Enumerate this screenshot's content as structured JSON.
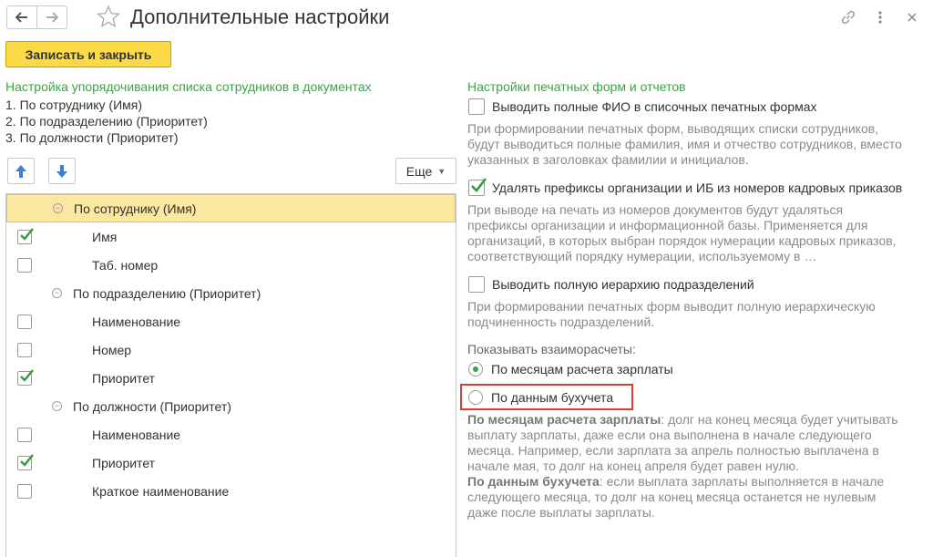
{
  "window": {
    "title": "Дополнительные настройки",
    "nav_back_icon": "arrow-left-icon",
    "nav_forward_icon": "arrow-right-icon",
    "favorite_icon": "star-icon",
    "link_icon": "link-icon",
    "more_icon": "vertical-dots-icon",
    "close_icon": "close-icon"
  },
  "toolbar": {
    "save_close_label": "Записать и закрыть"
  },
  "left": {
    "section_title": "Настройка упорядочивания списка сотрудников в документах",
    "order_lines": [
      "1. По сотруднику (Имя)",
      "2. По подразделению (Приоритет)",
      "3. По должности (Приоритет)"
    ],
    "more_label": "Еще",
    "tree": [
      {
        "type": "group",
        "label": "По сотруднику (Имя)",
        "selected": true
      },
      {
        "type": "item",
        "label": "Имя",
        "checked": true
      },
      {
        "type": "item",
        "label": "Таб. номер",
        "checked": false
      },
      {
        "type": "group",
        "label": "По подразделению (Приоритет)",
        "selected": false
      },
      {
        "type": "item",
        "label": "Наименование",
        "checked": false
      },
      {
        "type": "item",
        "label": "Номер",
        "checked": false
      },
      {
        "type": "item",
        "label": "Приоритет",
        "checked": true
      },
      {
        "type": "group",
        "label": "По должности (Приоритет)",
        "selected": false
      },
      {
        "type": "item",
        "label": "Наименование",
        "checked": false
      },
      {
        "type": "item",
        "label": "Приоритет",
        "checked": true
      },
      {
        "type": "item",
        "label": "Краткое наименование",
        "checked": false
      }
    ]
  },
  "right": {
    "section_title": "Настройки печатных форм и отчетов",
    "opt_full_fio": {
      "label": "Выводить полные ФИО в списочных печатных формах",
      "checked": false,
      "hint": "При формировании печатных форм, выводящих списки сотрудников, будут выводиться полные фамилия, имя и отчество сотрудников, вместо указанных в заголовках фамилии и инициалов."
    },
    "opt_prefixes": {
      "label": "Удалять префиксы организации и ИБ из номеров кадровых приказов",
      "checked": true,
      "hint": "При выводе на печать из номеров документов будут удаляться префиксы организации и информационной базы. Применяется для организаций, в которых выбран порядок нумерации кадровых приказов, соответствующий порядку нумерации, используемому в …"
    },
    "opt_hierarchy": {
      "label": "Выводить полную иерархию подразделений",
      "checked": false,
      "hint": "При формировании печатных форм выводит полную иерархическую подчиненность подразделений."
    },
    "settlements": {
      "label": "Показывать взаиморасчеты:",
      "option_months": "По месяцам расчета зарплаты",
      "option_accounting": "По данным бухучета",
      "selected": "option_months"
    },
    "description": {
      "months_bold": "По месяцам расчета зарплаты",
      "months_text": ": долг на конец месяца будет учитывать выплату зарплаты, даже если она выполнена в начале следующего месяца. Например, если зарплата за апрель полностью выплачена в начале мая, то долг на конец апреля будет равен нулю.",
      "accounting_bold": "По данным бухучета",
      "accounting_text": ": если выплата зарплаты выполняется в начале следующего месяца, то долг на конец месяца останется не нулевым даже после выплаты зарплаты."
    }
  },
  "colors": {
    "accent_green": "#3aa544",
    "primary_button": "#fbd947",
    "selected_row": "#fbe8a0",
    "highlight_border": "#e53935",
    "hint_text": "#8a8a8a"
  }
}
